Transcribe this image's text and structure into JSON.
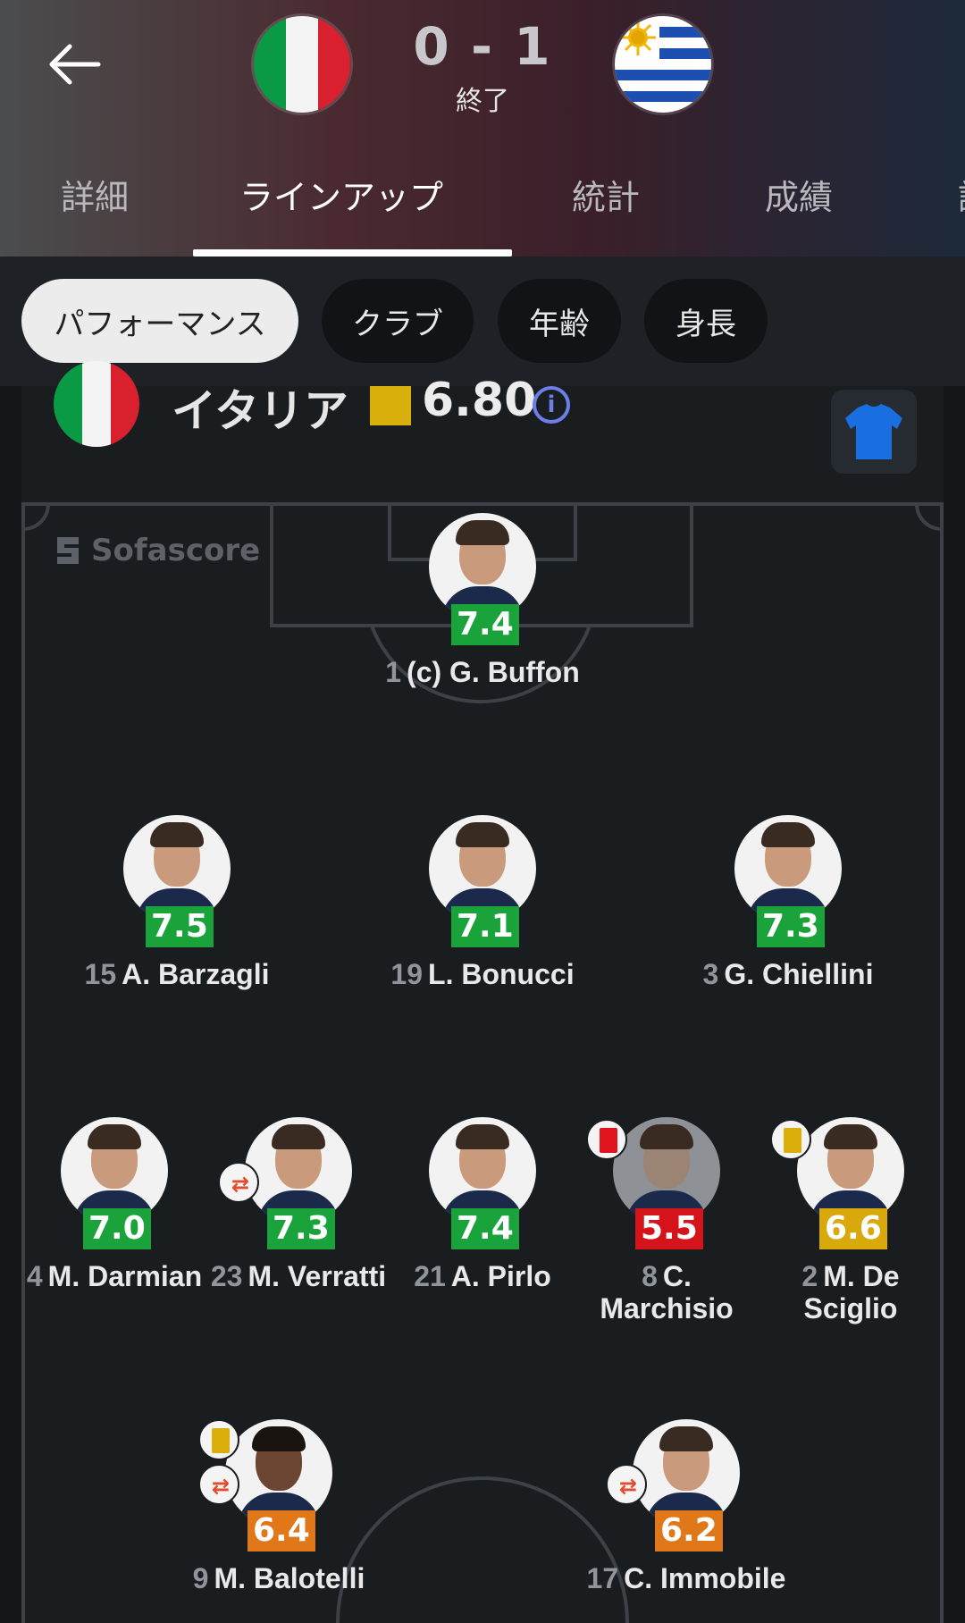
{
  "header": {
    "score": "0 - 1",
    "status": "終了",
    "home_flag": "italy-flag",
    "away_flag": "uruguay-flag",
    "tabs": [
      "詳細",
      "ラインアップ",
      "統計",
      "成績",
      "詳"
    ]
  },
  "filters": [
    "パフォーマンス",
    "クラブ",
    "年齢",
    "身長"
  ],
  "team": {
    "name": "イタリア",
    "rating": "6.80",
    "rating_color": "#d9b00b",
    "shirt_color": "#1a6fe0"
  },
  "watermark": "Sofascore",
  "players": [
    {
      "num": "1",
      "name": "(c) G. Buffon",
      "rating": "7.4",
      "rating_color": "green"
    },
    {
      "num": "15",
      "name": "A. Barzagli",
      "rating": "7.5",
      "rating_color": "green"
    },
    {
      "num": "19",
      "name": "L. Bonucci",
      "rating": "7.1",
      "rating_color": "green"
    },
    {
      "num": "3",
      "name": "G. Chiellini",
      "rating": "7.3",
      "rating_color": "green"
    },
    {
      "num": "4",
      "name": "M. Darmian",
      "rating": "7.0",
      "rating_color": "green"
    },
    {
      "num": "23",
      "name": "M. Verratti",
      "rating": "7.3",
      "rating_color": "green",
      "badge": "substitution-icon"
    },
    {
      "num": "21",
      "name": "A. Pirlo",
      "rating": "7.4",
      "rating_color": "green"
    },
    {
      "num": "8",
      "name": "C.",
      "name2": "Marchisio",
      "rating": "5.5",
      "rating_color": "red",
      "badge": "red-card-icon"
    },
    {
      "num": "2",
      "name": "M. De",
      "name2": "Sciglio",
      "rating": "6.6",
      "rating_color": "yellow",
      "badge": "yellow-card-icon"
    },
    {
      "num": "9",
      "name": "M. Balotelli",
      "rating": "6.4",
      "rating_color": "orange",
      "badge": "yellow-card-icon",
      "badge2": "substitution-icon"
    },
    {
      "num": "17",
      "name": "C. Immobile",
      "rating": "6.2",
      "rating_color": "orange",
      "badge": "substitution-icon"
    }
  ]
}
